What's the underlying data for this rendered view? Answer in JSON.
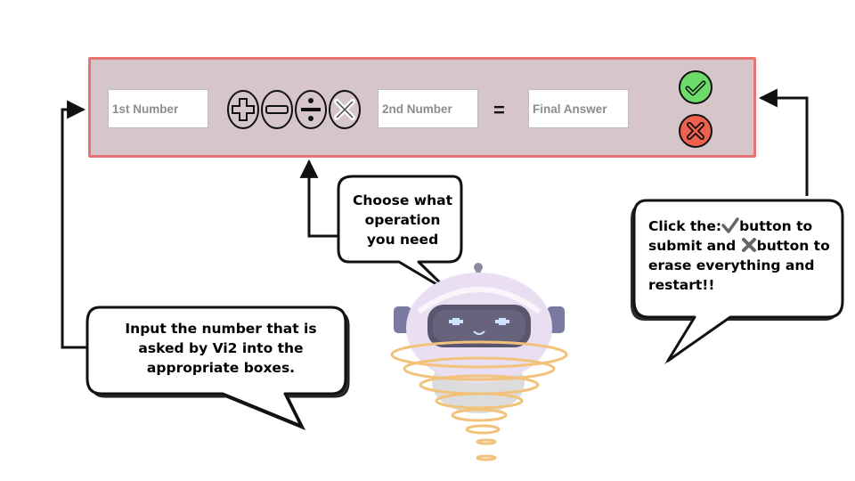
{
  "calculator": {
    "first_placeholder": "1st Number",
    "second_placeholder": "2nd Number",
    "answer_placeholder": "Final Answer",
    "equals": "=",
    "operations": [
      "plus-icon",
      "minus-icon",
      "divide-icon",
      "times-icon"
    ],
    "submit_color": "#6cdb6a",
    "clear_color": "#f0604e"
  },
  "callouts": {
    "operation_text": [
      "Choose what",
      "operation",
      "you need"
    ],
    "input_text": [
      "Input the number that is",
      "asked by Vi2 into the",
      "appropriate boxes."
    ],
    "buttons_text": {
      "line1_a": "Click the:",
      "line1_b": "button to",
      "line2_a": "submit and ",
      "line2_b": "button to",
      "line3": "erase everything and",
      "line4": "restart!!"
    }
  },
  "colors": {
    "panel_bg": "#d6c6ca",
    "panel_border": "#e97373",
    "robot_body": "#eadff2",
    "robot_ring": "#f2c27a"
  }
}
